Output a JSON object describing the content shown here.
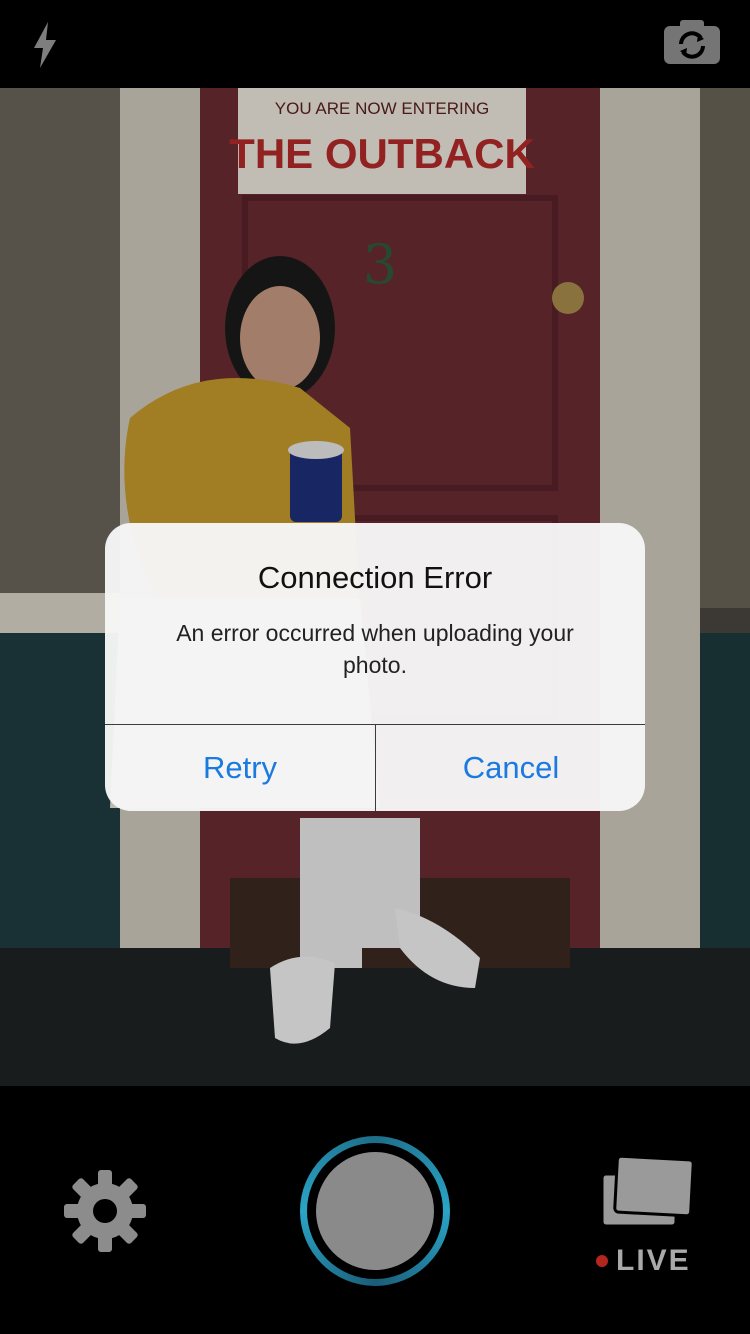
{
  "top_bar": {
    "flash_icon": "flash-icon",
    "flip_camera_icon": "flip-camera-icon"
  },
  "viewfinder": {
    "sign_line1": "YOU ARE NOW ENTERING",
    "sign_line2": "THE OUTBACK",
    "door_number": "3"
  },
  "alert": {
    "title": "Connection Error",
    "message": "An error occurred when uploading your photo.",
    "buttons": {
      "retry": "Retry",
      "cancel": "Cancel"
    },
    "accent_color": "#1a7ae0"
  },
  "bottom_bar": {
    "settings_icon": "gear-icon",
    "shutter": "shutter-button",
    "gallery_icon": "gallery-stack-icon",
    "live_label": "LIVE",
    "live_dot_color": "#b3261e"
  }
}
